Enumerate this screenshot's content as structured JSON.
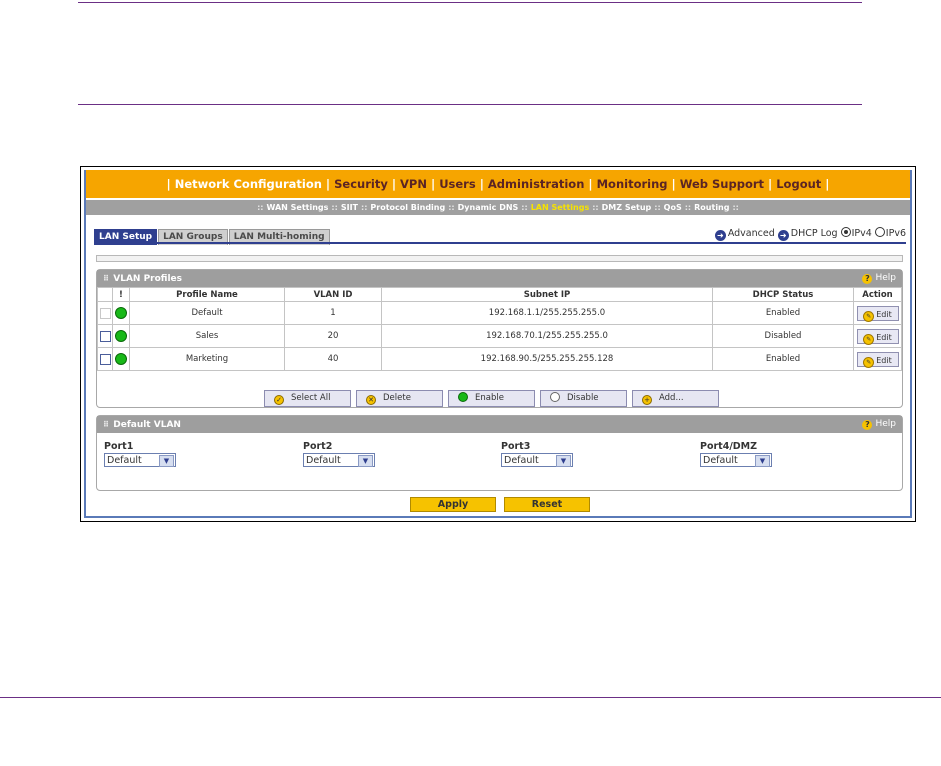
{
  "top_nav": {
    "items": [
      "Network Configuration",
      "Security",
      "VPN",
      "Users",
      "Administration",
      "Monitoring",
      "Web Support",
      "Logout"
    ]
  },
  "sub_nav": {
    "items": [
      "WAN Settings",
      "SIIT",
      "Protocol Binding",
      "Dynamic DNS",
      "LAN Settings",
      "DMZ Setup",
      "QoS",
      "Routing"
    ],
    "selected": "LAN Settings"
  },
  "tabs": [
    "LAN Setup",
    "LAN Groups",
    "LAN Multi-homing"
  ],
  "right_links": {
    "advanced": "Advanced",
    "dhcp_log": "DHCP Log",
    "ipv4": "IPv4",
    "ipv6": "IPv6",
    "selected_ip": "IPv4"
  },
  "vlan_profiles": {
    "title": "VLAN Profiles",
    "help": "Help",
    "columns": [
      "!",
      "Profile Name",
      "VLAN ID",
      "Subnet IP",
      "DHCP Status",
      "Action"
    ],
    "rows": [
      {
        "name": "Default",
        "vlan_id": "1",
        "subnet": "192.168.1.1/255.255.255.0",
        "dhcp": "Enabled",
        "action": "Edit",
        "status_color": "#18b818",
        "checkbox_enabled": false
      },
      {
        "name": "Sales",
        "vlan_id": "20",
        "subnet": "192.168.70.1/255.255.255.0",
        "dhcp": "Disabled",
        "action": "Edit",
        "status_color": "#18b818",
        "checkbox_enabled": true
      },
      {
        "name": "Marketing",
        "vlan_id": "40",
        "subnet": "192.168.90.5/255.255.255.128",
        "dhcp": "Enabled",
        "action": "Edit",
        "status_color": "#18b818",
        "checkbox_enabled": true
      }
    ]
  },
  "buttons": {
    "select_all": "Select All",
    "delete": "Delete",
    "enable": "Enable",
    "disable": "Disable",
    "add": "Add..."
  },
  "default_vlan": {
    "title": "Default VLAN",
    "help": "Help",
    "ports": [
      {
        "label": "Port1",
        "value": "Default"
      },
      {
        "label": "Port2",
        "value": "Default"
      },
      {
        "label": "Port3",
        "value": "Default"
      },
      {
        "label": "Port4/DMZ",
        "value": "Default"
      }
    ]
  },
  "actions": {
    "apply": "Apply",
    "reset": "Reset"
  },
  "colors": {
    "nav_orange": "#f6a500",
    "tab_blue": "#2f3f8f",
    "rule_purple": "#6b2f85"
  }
}
